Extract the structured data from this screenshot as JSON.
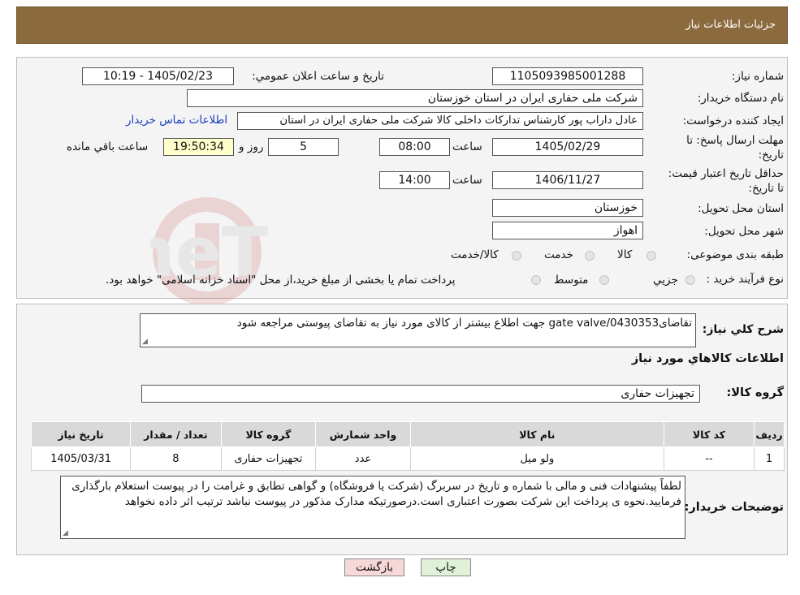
{
  "header": {
    "title": "جزئیات اطلاعات نیاز"
  },
  "info": {
    "need_number_label": "شماره نياز:",
    "need_number": "1105093985001288",
    "announce_label": "تاريخ و ساعت اعلان عمومي:",
    "announce_value": "1405/02/23 - 10:19",
    "buyer_label": "نام دستگاه خريدار:",
    "buyer_value": "شرکت ملی حفاری ایران در استان خوزستان",
    "creator_label": "ايجاد کننده درخواست:",
    "creator_value": "عادل داراب پور کارشناس تدارکات داخلی کالا شرکت ملی حفاری ایران در استان",
    "contact_link": "اطلاعات تماس خريدار",
    "deadline_label": "مهلت ارسال پاسخ: تا تاريخ:",
    "deadline_date": "1405/02/29",
    "time_label": "ساعت",
    "deadline_time": "08:00",
    "days_value": "5",
    "days_label": "روز و",
    "remaining_time": "19:50:34",
    "remaining_label": "ساعت باقي مانده",
    "validity_label": "حداقل تاريخ اعتبار قيمت: تا تاريخ:",
    "validity_date": "1406/11/27",
    "validity_time": "14:00",
    "province_label": "استان محل تحويل:",
    "province_value": "خوزستان",
    "city_label": "شهر محل تحويل:",
    "city_value": "اهواز",
    "category_label": "طبقه بندی موضوعی:",
    "category_options": [
      "کالا",
      "خدمت",
      "کالا/خدمت"
    ],
    "process_label": "نوع فرآيند خريد :",
    "process_options": [
      "جزيي",
      "متوسط"
    ],
    "process_note": "پرداخت تمام يا بخشی از مبلغ خريد،از محل \"اسناد خزانه اسلامی\" خواهد بود."
  },
  "details": {
    "description_label": "شرح کلي نياز:",
    "description_value": "تقاضایgate valve/0430353 جهت اطلاع بیشتر از کالای مورد نیاز به تقاضای پیوستی مراجعه شود",
    "goods_title": "اطلاعات کالاهاي مورد نياز",
    "group_label": "گروه کالا:",
    "group_value": "تجهیزات حفاری",
    "table": {
      "headers": [
        "رديف",
        "کد کالا",
        "نام کالا",
        "واحد شمارش",
        "گروه کالا",
        "تعداد / مقدار",
        "تاريخ نياز"
      ],
      "rows": [
        [
          "1",
          "--",
          "ولو میل",
          "عدد",
          "تجهيزات حفاری",
          "8",
          "1405/03/31"
        ]
      ]
    },
    "notes_label": "توضيحات خريدار:",
    "notes_value": "لطفاً پیشنهادات فنی و مالی با شماره و تاریخ در سربرگ (شرکت یا فروشگاه) و گواهی تطابق و غرامت را در پیوست استعلام بارگذاری فرمایید.نحوه ی پرداخت این شرکت بصورت اعتباری است.درصورتیکه مدارک مذکور در پیوست نباشد ترتیب اثر داده نخواهد"
  },
  "buttons": {
    "print": "چاپ",
    "back": "بازگشت"
  },
  "watermark": {
    "text": "AriaTender.neT"
  }
}
